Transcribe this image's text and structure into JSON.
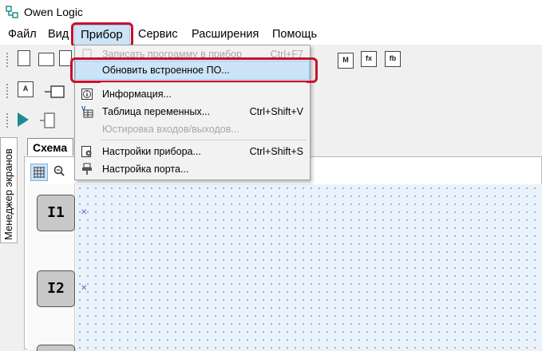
{
  "window": {
    "title": "Owen Logic"
  },
  "menubar": {
    "items": [
      {
        "id": "file",
        "label": "Файл"
      },
      {
        "id": "view",
        "label": "Вид"
      },
      {
        "id": "device",
        "label": "Прибор"
      },
      {
        "id": "service",
        "label": "Сервис"
      },
      {
        "id": "extensions",
        "label": "Расширения"
      },
      {
        "id": "help",
        "label": "Помощь"
      }
    ],
    "active": "Прибор"
  },
  "device_menu": {
    "items": [
      {
        "label": "Записать программу в прибор",
        "shortcut": "Ctrl+F7",
        "enabled": false,
        "icon": "write-to-device-icon"
      },
      {
        "label": "Обновить встроенное ПО...",
        "shortcut": "",
        "enabled": true,
        "highlighted": true,
        "icon": ""
      },
      {
        "label": "Информация...",
        "shortcut": "",
        "enabled": true,
        "icon": "info-icon"
      },
      {
        "label": "Таблица переменных...",
        "shortcut": "Ctrl+Shift+V",
        "enabled": true,
        "icon": "variables-table-icon"
      },
      {
        "label": "Юстировка входов/выходов...",
        "shortcut": "",
        "enabled": false,
        "icon": ""
      },
      {
        "label": "Настройки прибора...",
        "shortcut": "Ctrl+Shift+S",
        "enabled": true,
        "icon": "device-settings-icon"
      },
      {
        "label": "Настройка порта...",
        "shortcut": "",
        "enabled": true,
        "icon": "port-settings-icon"
      }
    ]
  },
  "side_panel": {
    "label": "Менеджер экранов"
  },
  "document_tabs": [
    {
      "label": "Схема",
      "active": true
    }
  ],
  "schema": {
    "inputs": [
      {
        "label": "I1"
      },
      {
        "label": "I2"
      }
    ]
  },
  "colors": {
    "highlight": "#cce4f7",
    "annotation_ring": "#c8102e",
    "canvas_bg": "#eaf3fb",
    "run_button": "#1f8a94"
  }
}
